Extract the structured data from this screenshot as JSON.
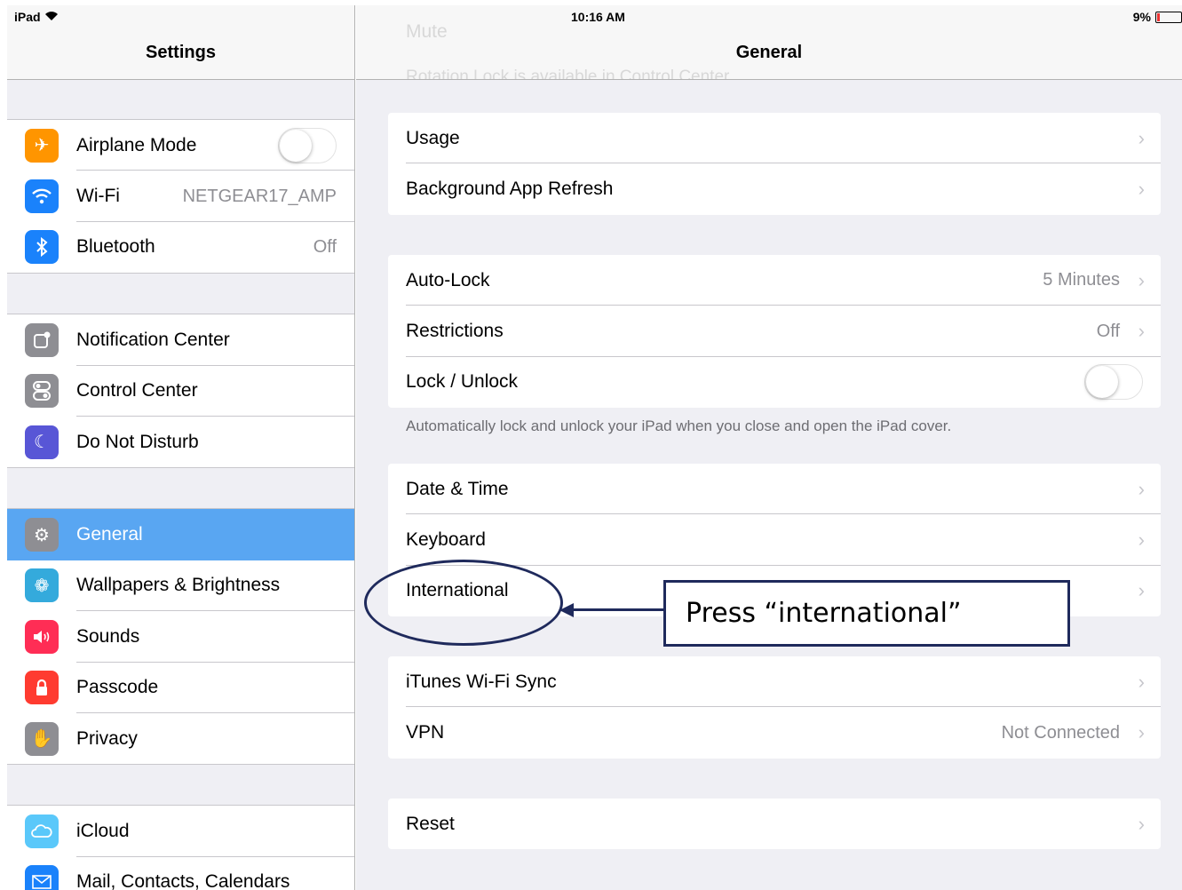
{
  "status_bar": {
    "carrier": "iPad",
    "time": "10:16 AM",
    "battery": "9%"
  },
  "sidebar": {
    "title": "Settings",
    "groups": [
      {
        "items": [
          {
            "label": "Airplane Mode",
            "icon": "airplane-icon",
            "color": "#ff9500",
            "toggle": "off"
          },
          {
            "label": "Wi-Fi",
            "icon": "wifi-icon",
            "color": "#1a82fb",
            "value": "NETGEAR17_AMP"
          },
          {
            "label": "Bluetooth",
            "icon": "bluetooth-icon",
            "color": "#1a82fb",
            "value": "Off"
          }
        ]
      },
      {
        "items": [
          {
            "label": "Notification Center",
            "icon": "notification-center-icon",
            "color": "#8e8e93"
          },
          {
            "label": "Control Center",
            "icon": "control-center-icon",
            "color": "#8e8e93"
          },
          {
            "label": "Do Not Disturb",
            "icon": "moon-icon",
            "color": "#5856d6"
          }
        ]
      },
      {
        "items": [
          {
            "label": "General",
            "icon": "gear-icon",
            "color": "#8e8e93",
            "selected": true
          },
          {
            "label": "Wallpapers & Brightness",
            "icon": "flower-icon",
            "color": "#34aadc"
          },
          {
            "label": "Sounds",
            "icon": "speaker-icon",
            "color": "#ff2d55"
          },
          {
            "label": "Passcode",
            "icon": "lock-icon",
            "color": "#ff3b30"
          },
          {
            "label": "Privacy",
            "icon": "hand-icon",
            "color": "#8e8e93"
          }
        ]
      },
      {
        "items": [
          {
            "label": "iCloud",
            "icon": "cloud-icon",
            "color": "#5ac8fa"
          },
          {
            "label": "Mail, Contacts, Calendars",
            "icon": "mail-icon",
            "color": "#1a82fb"
          }
        ]
      }
    ]
  },
  "main": {
    "title": "General",
    "ghost_text": {
      "top": "Mute",
      "bottom": "Rotation Lock is available in Control Center."
    },
    "groups": [
      {
        "items": [
          {
            "label": "Usage"
          },
          {
            "label": "Background App Refresh"
          }
        ]
      },
      {
        "items": [
          {
            "label": "Auto-Lock",
            "value": "5 Minutes"
          },
          {
            "label": "Restrictions",
            "value": "Off"
          },
          {
            "label": "Lock / Unlock",
            "toggle": "off"
          }
        ],
        "footnote": "Automatically lock and unlock your iPad when you close and open the iPad cover."
      },
      {
        "items": [
          {
            "label": "Date & Time"
          },
          {
            "label": "Keyboard"
          },
          {
            "label": "International"
          }
        ]
      },
      {
        "items": [
          {
            "label": "iTunes Wi-Fi Sync"
          },
          {
            "label": "VPN",
            "value": "Not Connected"
          }
        ]
      },
      {
        "items": [
          {
            "label": "Reset"
          }
        ]
      }
    ]
  },
  "annotation": {
    "callout_text": "Press “international”"
  },
  "colors": {
    "selected": "#59a6f2",
    "annotation": "#1f2a5c"
  }
}
